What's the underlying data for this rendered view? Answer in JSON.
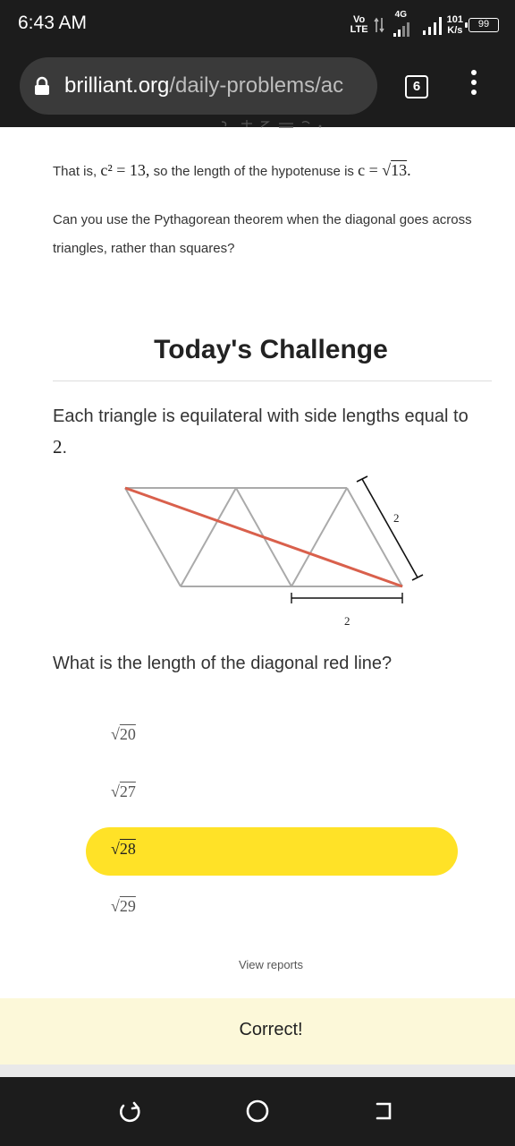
{
  "status_bar": {
    "time": "6:43 AM",
    "volte_top": "Vo",
    "volte_bottom": "LTE",
    "network": "4G",
    "speed_value": "101",
    "speed_unit": "K/s",
    "battery": "99"
  },
  "browser": {
    "url_host": "brilliant.org",
    "url_path": "/daily-problems/ac",
    "tab_count": "6"
  },
  "content": {
    "para1_prefix": "That is, ",
    "para1_math1": "c² = 13,",
    "para1_middle": " so the length of the hypotenuse is ",
    "para1_math2_pre": "c = √",
    "para1_math2_rad": "13",
    "para1_math2_post": ".",
    "para2": "Can you use the Pythagorean theorem when the diagonal goes across triangles, rather than squares?",
    "section_title": "Today's Challenge",
    "prompt_text": "Each triangle is equilateral with side lengths equal to ",
    "prompt_value": "2",
    "prompt_end": ".",
    "figure_label_side": "2",
    "figure_label_bottom": "2",
    "question": "What is the length of the diagonal red line?"
  },
  "choices": [
    {
      "radicand": "20",
      "selected": false
    },
    {
      "radicand": "27",
      "selected": false
    },
    {
      "radicand": "28",
      "selected": true
    },
    {
      "radicand": "29",
      "selected": false
    }
  ],
  "view_reports": "View reports",
  "feedback": "Correct!",
  "colors": {
    "selected_choice": "#ffe227",
    "diagonal_line": "#d9604c",
    "triangle_lines": "#aaaaaa",
    "feedback_bg": "#fcf8d9"
  }
}
